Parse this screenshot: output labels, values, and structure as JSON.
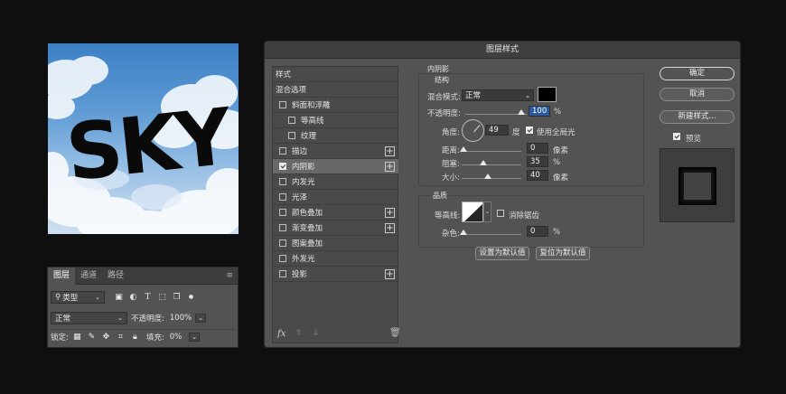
{
  "canvas": {
    "text": "SKY"
  },
  "layers_panel": {
    "tabs": [
      "图层",
      "通道",
      "路径"
    ],
    "filter_label": "类型",
    "blend_mode": "正常",
    "opacity_label": "不透明度:",
    "opacity_value": "100%",
    "lock_label": "锁定:",
    "fill_label": "填充:",
    "fill_value": "0%"
  },
  "dialog": {
    "title": "图层样式",
    "style_list": [
      {
        "label": "样式",
        "checkbox": false,
        "plus": false,
        "indent": 0
      },
      {
        "label": "混合选项",
        "checkbox": false,
        "plus": false,
        "indent": 0
      },
      {
        "label": "斜面和浮雕",
        "checkbox": true,
        "checked": false,
        "plus": false,
        "indent": 0
      },
      {
        "label": "等高线",
        "checkbox": true,
        "checked": false,
        "plus": false,
        "indent": 1
      },
      {
        "label": "纹理",
        "checkbox": true,
        "checked": false,
        "plus": false,
        "indent": 1
      },
      {
        "label": "描边",
        "checkbox": true,
        "checked": false,
        "plus": true,
        "indent": 0
      },
      {
        "label": "内阴影",
        "checkbox": true,
        "checked": true,
        "plus": true,
        "indent": 0,
        "selected": true
      },
      {
        "label": "内发光",
        "checkbox": true,
        "checked": false,
        "plus": false,
        "indent": 0
      },
      {
        "label": "光泽",
        "checkbox": true,
        "checked": false,
        "plus": false,
        "indent": 0
      },
      {
        "label": "颜色叠加",
        "checkbox": true,
        "checked": false,
        "plus": true,
        "indent": 0
      },
      {
        "label": "渐变叠加",
        "checkbox": true,
        "checked": false,
        "plus": true,
        "indent": 0
      },
      {
        "label": "图案叠加",
        "checkbox": true,
        "checked": false,
        "plus": false,
        "indent": 0
      },
      {
        "label": "外发光",
        "checkbox": true,
        "checked": false,
        "plus": false,
        "indent": 0
      },
      {
        "label": "投影",
        "checkbox": true,
        "checked": false,
        "plus": true,
        "indent": 0
      }
    ],
    "fx_label": "fx",
    "inner_shadow": {
      "section_title": "内阴影",
      "structure_title": "结构",
      "blend_mode_label": "混合模式:",
      "blend_mode_value": "正常",
      "shadow_color": "#000000",
      "opacity_label": "不透明度:",
      "opacity_value": "100",
      "opacity_unit": "%",
      "angle_label": "角度:",
      "angle_value": "49",
      "angle_unit": "度",
      "global_light_label": "使用全局光",
      "global_light_checked": true,
      "distance_label": "距离:",
      "distance_value": "0",
      "distance_unit": "像素",
      "choke_label": "阻塞:",
      "choke_value": "35",
      "choke_unit": "%",
      "size_label": "大小:",
      "size_value": "40",
      "size_unit": "像素",
      "quality_title": "品质",
      "contour_label": "等高线:",
      "antialias_label": "消除锯齿",
      "antialias_checked": false,
      "noise_label": "杂色:",
      "noise_value": "0",
      "noise_unit": "%",
      "make_default_label": "设置为默认值",
      "reset_default_label": "复位为默认值"
    },
    "buttons": {
      "ok": "确定",
      "cancel": "取消",
      "new_style": "新建样式...",
      "preview_label": "预览",
      "preview_checked": true
    }
  }
}
